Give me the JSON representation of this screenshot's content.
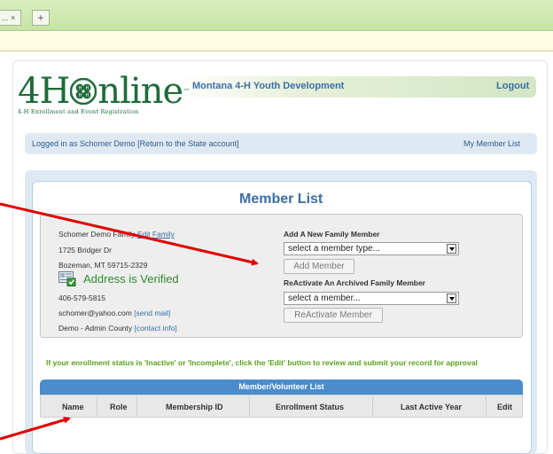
{
  "browser": {
    "tab_label": "... ×",
    "new_tab_glyph": "+"
  },
  "logo": {
    "mark_left": "4H",
    "mark_right": "nline",
    "trademark": "™",
    "subtitle": "4-H Enrollment and Event Registration"
  },
  "header": {
    "site_title": "Montana 4-H Youth Development",
    "logout_label": "Logout"
  },
  "status": {
    "logged_in_text": "Logged in as Schomer Demo [Return to the State account]",
    "member_list_link": "My Member List"
  },
  "page": {
    "title": "Member List"
  },
  "family": {
    "name": "Schomer Demo Family",
    "edit_link": "Edit Family",
    "address_line1": "1725 Bridger Dr",
    "address_line2": "Bozeman, MT 59715-2329",
    "address_verified": "Address is Verified",
    "phone": "406-579-5815",
    "email": "schomer@yahoo.com",
    "send_mail_link": "[send mail]",
    "county": "Demo - Admin County",
    "contact_info_link": "[contact info]"
  },
  "add_member": {
    "heading": "Add A New Family Member",
    "select_value": "select a member type...",
    "button_label": "Add Member"
  },
  "reactivate": {
    "heading": "ReActivate An Archived Family Member",
    "select_value": "select a member...",
    "button_label": "ReActivate Member"
  },
  "notice": "If your enrollment status is 'Inactive' or 'Incomplete', click the 'Edit' button to review and submit your record for approval",
  "table": {
    "title": "Member/Volunteer List",
    "columns": [
      "Name",
      "Role",
      "Membership ID",
      "Enrollment Status",
      "Last Active Year",
      "Edit"
    ]
  },
  "colors": {
    "link_blue": "#3b6ea5",
    "logo_green": "#1f6b3a",
    "notice_green": "#5aa11a",
    "table_header": "#4a8ccc",
    "verified_green": "#2e8b2e",
    "annotation_red": "#e00000"
  }
}
